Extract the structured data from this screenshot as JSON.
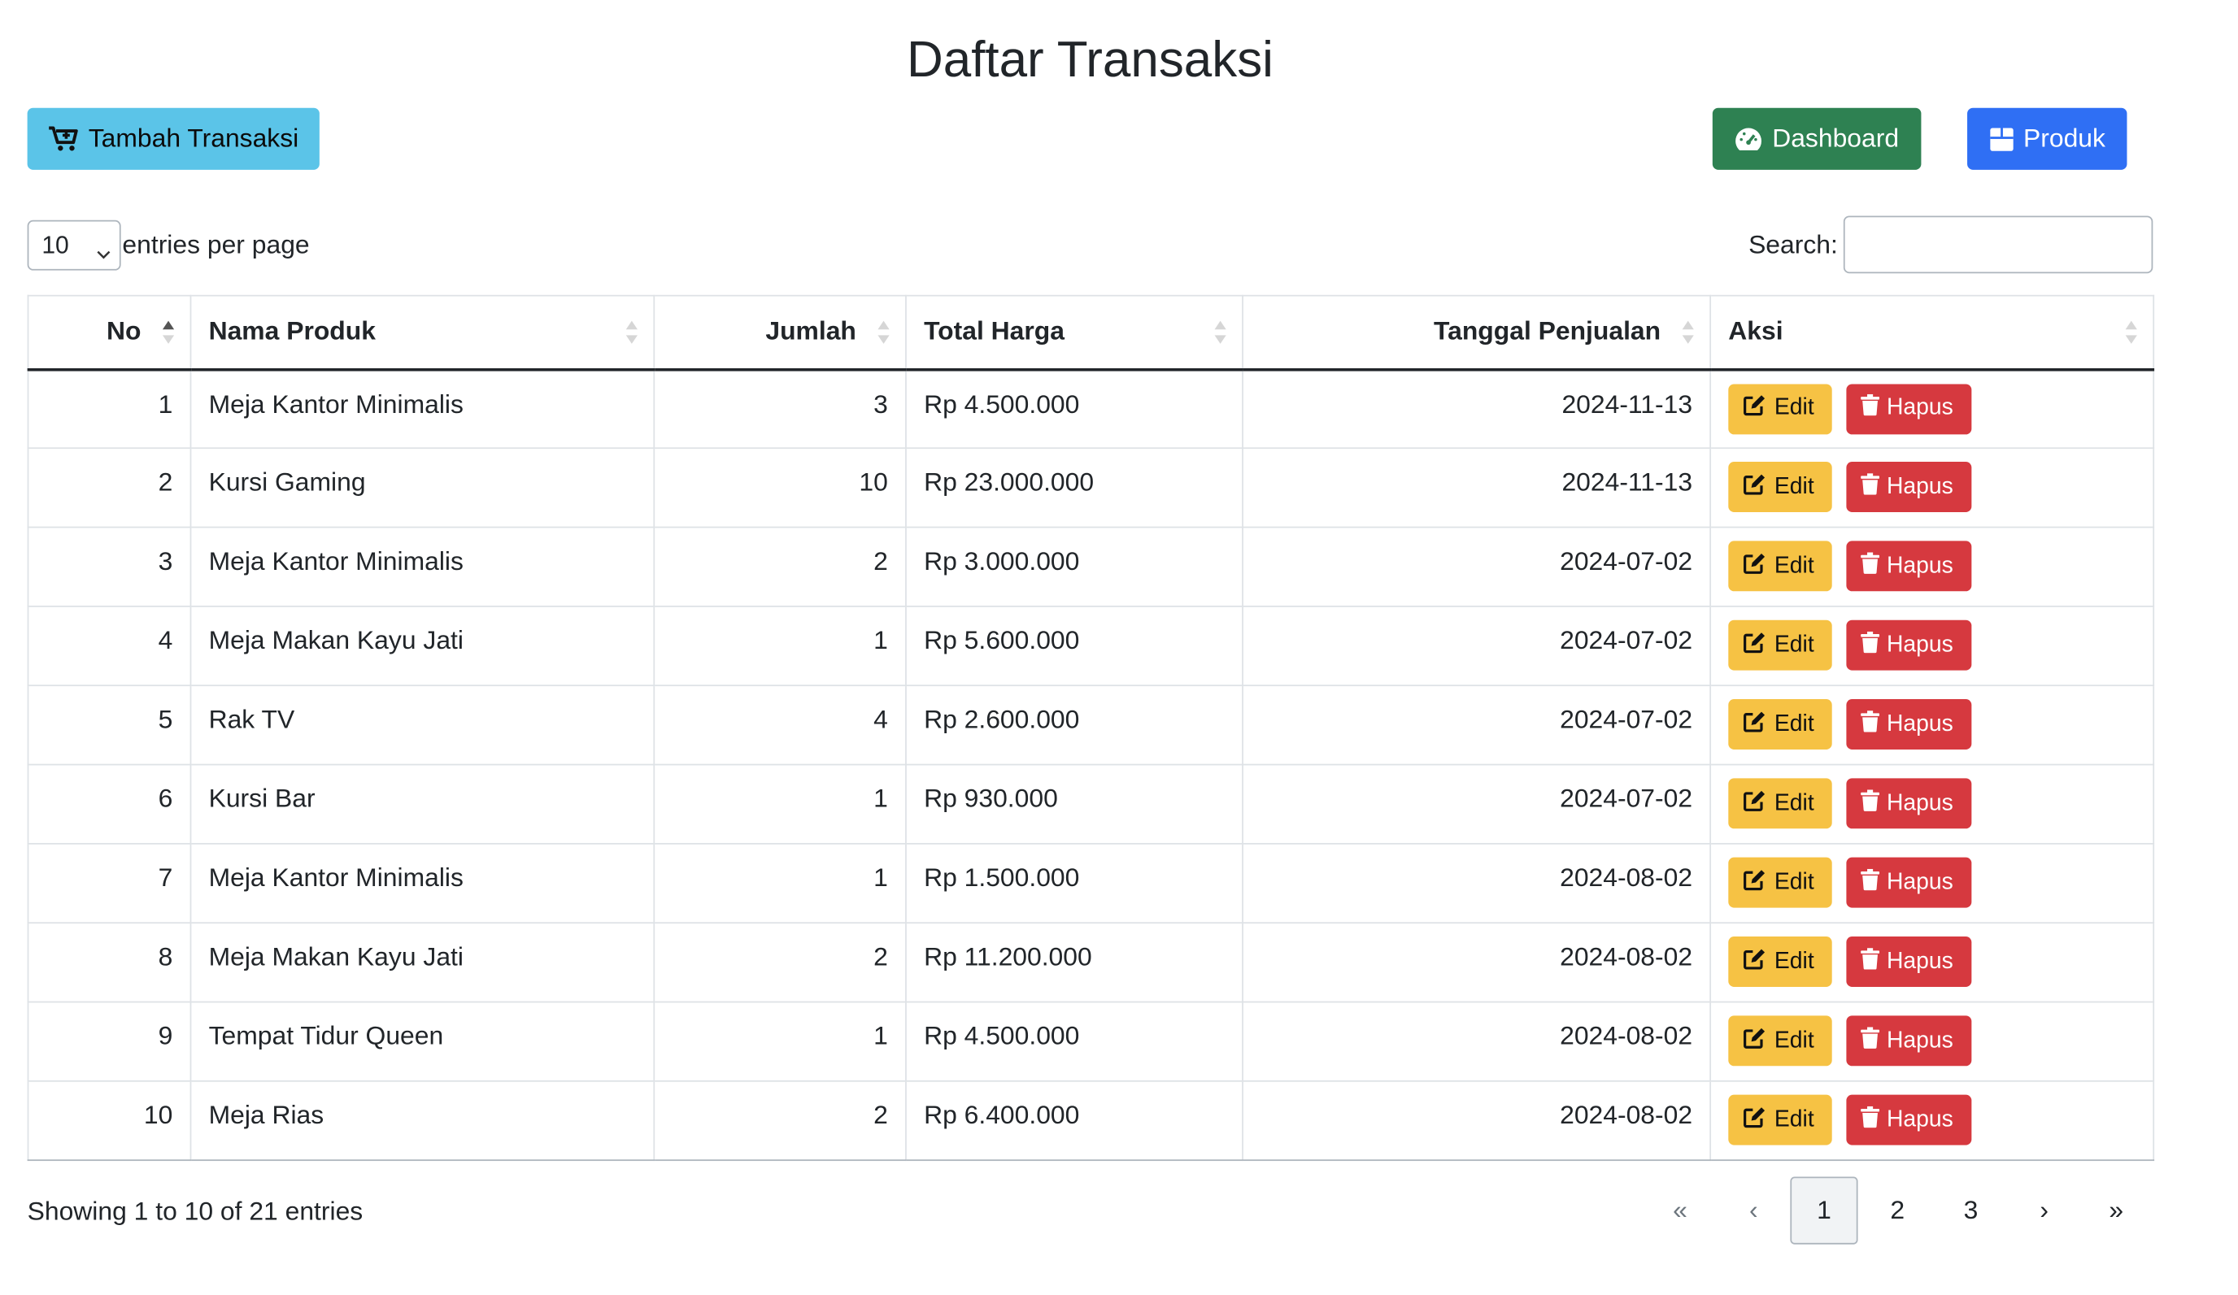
{
  "page": {
    "title": "Daftar Transaksi"
  },
  "toolbar": {
    "add_label": "Tambah Transaksi",
    "dashboard_label": "Dashboard",
    "produk_label": "Produk"
  },
  "length": {
    "selected": "10",
    "label": "entries per page"
  },
  "search": {
    "label": "Search:",
    "value": "",
    "placeholder": ""
  },
  "table": {
    "headers": {
      "no": "No",
      "nama": "Nama Produk",
      "jumlah": "Jumlah",
      "total": "Total Harga",
      "tanggal": "Tanggal Penjualan",
      "aksi": "Aksi"
    },
    "edit_label": "Edit",
    "delete_label": "Hapus",
    "rows": [
      {
        "no": "1",
        "nama": "Meja Kantor Minimalis",
        "jumlah": "3",
        "total": "Rp 4.500.000",
        "tanggal": "2024-11-13"
      },
      {
        "no": "2",
        "nama": "Kursi Gaming",
        "jumlah": "10",
        "total": "Rp 23.000.000",
        "tanggal": "2024-11-13"
      },
      {
        "no": "3",
        "nama": "Meja Kantor Minimalis",
        "jumlah": "2",
        "total": "Rp 3.000.000",
        "tanggal": "2024-07-02"
      },
      {
        "no": "4",
        "nama": "Meja Makan Kayu Jati",
        "jumlah": "1",
        "total": "Rp 5.600.000",
        "tanggal": "2024-07-02"
      },
      {
        "no": "5",
        "nama": "Rak TV",
        "jumlah": "4",
        "total": "Rp 2.600.000",
        "tanggal": "2024-07-02"
      },
      {
        "no": "6",
        "nama": "Kursi Bar",
        "jumlah": "1",
        "total": "Rp 930.000",
        "tanggal": "2024-07-02"
      },
      {
        "no": "7",
        "nama": "Meja Kantor Minimalis",
        "jumlah": "1",
        "total": "Rp 1.500.000",
        "tanggal": "2024-08-02"
      },
      {
        "no": "8",
        "nama": "Meja Makan Kayu Jati",
        "jumlah": "2",
        "total": "Rp 11.200.000",
        "tanggal": "2024-08-02"
      },
      {
        "no": "9",
        "nama": "Tempat Tidur Queen",
        "jumlah": "1",
        "total": "Rp 4.500.000",
        "tanggal": "2024-08-02"
      },
      {
        "no": "10",
        "nama": "Meja Rias",
        "jumlah": "2",
        "total": "Rp 6.400.000",
        "tanggal": "2024-08-02"
      }
    ]
  },
  "footer": {
    "info": "Showing 1 to 10 of 21 entries",
    "pagination": {
      "first": "«",
      "prev": "‹",
      "pages": [
        "1",
        "2",
        "3"
      ],
      "next": "›",
      "last": "»",
      "active": "1"
    }
  },
  "colors": {
    "add_button": "#5bc4e8",
    "dashboard_button": "#2e8152",
    "produk_button": "#2f6ff4",
    "edit_button": "#f6c244",
    "delete_button": "#d6393f"
  },
  "icons": {
    "add": "cart-plus-icon",
    "dashboard": "gauge-icon",
    "produk": "box-icon",
    "edit": "edit-icon",
    "delete": "trash-icon",
    "sort": "sort-icon"
  }
}
